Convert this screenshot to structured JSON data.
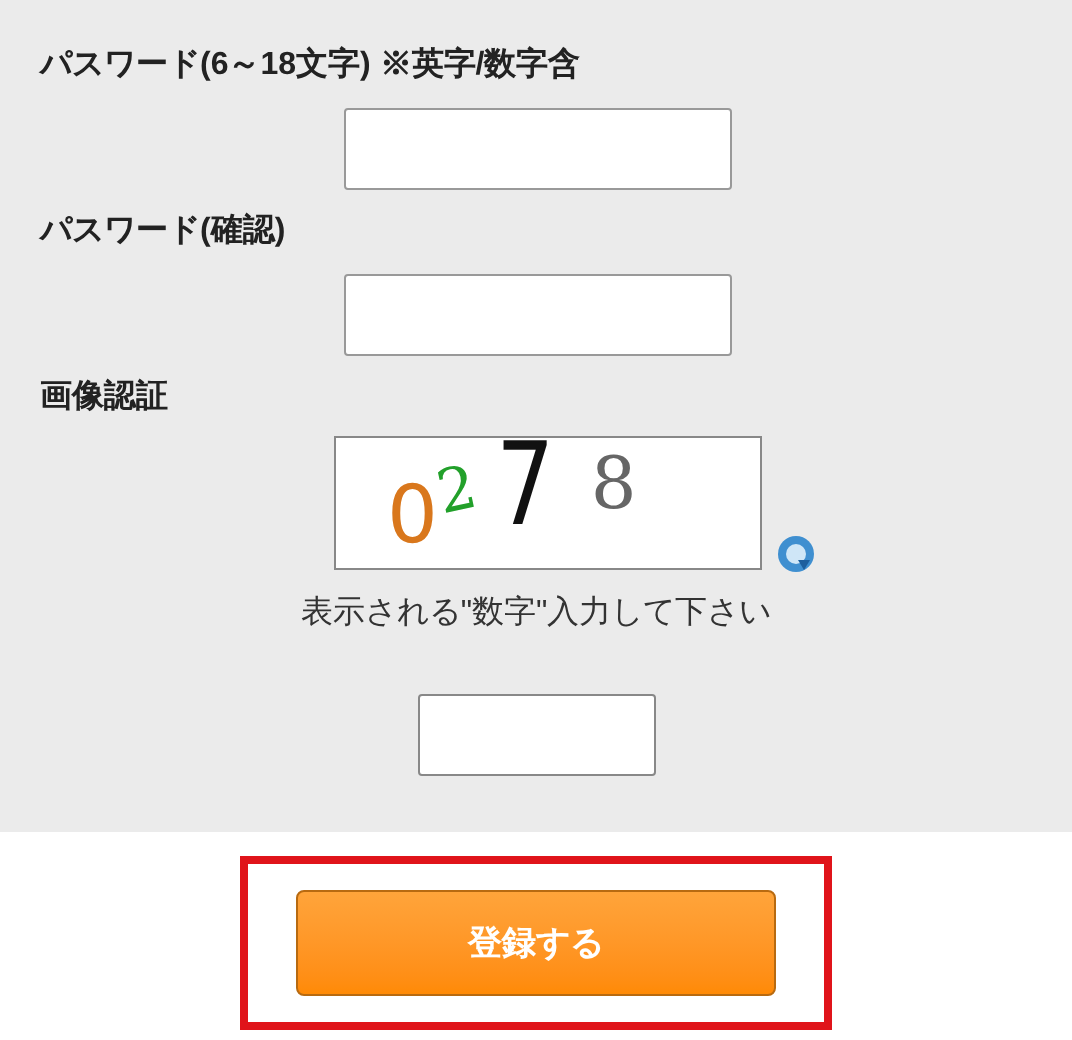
{
  "fields": [
    {
      "label": "パスワード(6～18文字) ※英字/数字含"
    },
    {
      "label": "パスワード(確認)"
    }
  ],
  "captcha": {
    "label": "画像認証",
    "chars": [
      {
        "text": "0",
        "color": "#d9771c"
      },
      {
        "text": "2",
        "color": "#22a02a"
      },
      {
        "text": "7",
        "color": "#111111"
      },
      {
        "text": "8",
        "color": "#666666"
      }
    ],
    "hint": "表示される\"数字\"入力して下さい"
  },
  "submit": {
    "label": "登録する",
    "highlighted": true
  }
}
